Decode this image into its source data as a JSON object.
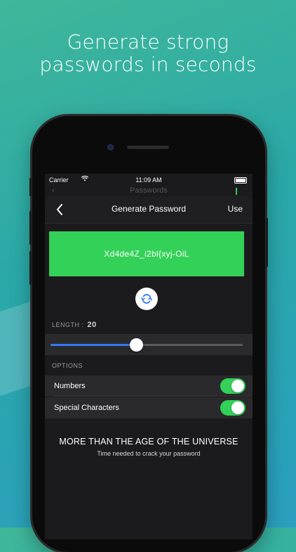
{
  "headline": {
    "line1": "Generate strong",
    "line2": "passwords in seconds"
  },
  "status_bar": {
    "carrier": "Carrier",
    "time": "11:09 AM"
  },
  "behind_nav": {
    "title": "Passwords"
  },
  "nav": {
    "title": "Generate Password",
    "use_label": "Use"
  },
  "password": {
    "value": "Xd4de4Z_i2bl{xyj-OiL",
    "box_color": "#33d158"
  },
  "length": {
    "label": "LENGTH :",
    "value": "20",
    "slider_fraction": 0.45
  },
  "options": {
    "header": "OPTIONS",
    "items": [
      {
        "label": "Numbers",
        "enabled": true
      },
      {
        "label": "Special Characters",
        "enabled": true
      }
    ]
  },
  "crack_time": {
    "title": "MORE THAN THE AGE OF THE UNIVERSE",
    "subtitle": "Time needed to crack your password"
  },
  "colors": {
    "accent_green": "#33d158",
    "slider_blue": "#3478f6",
    "screen_bg": "#1b1b1d"
  }
}
